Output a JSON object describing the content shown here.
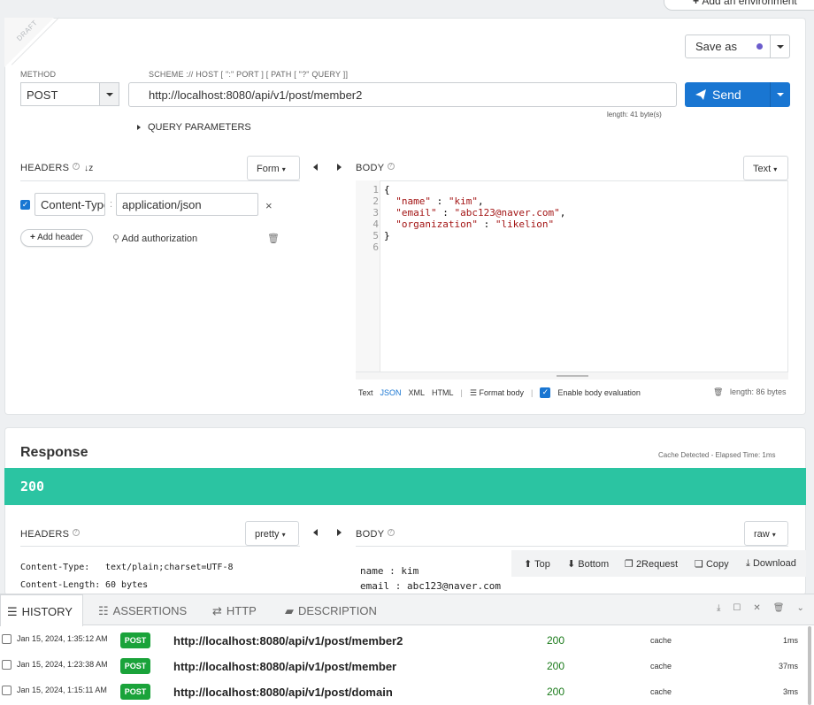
{
  "env": {
    "label": "Add an environment"
  },
  "draft": {
    "label": "DRAFT"
  },
  "request": {
    "method_label": "METHOD",
    "method_value": "POST",
    "scheme_label": "SCHEME :// HOST [ \":\" PORT ] [ PATH [ \"?\" QUERY ]]",
    "url": "http://localhost:8080/api/v1/post/member2",
    "url_length": "length: 41 byte(s)",
    "query_params": "QUERY PARAMETERS",
    "save_as": "Save as",
    "send": "Send"
  },
  "req_headers": {
    "title": "HEADERS",
    "mode": "Form",
    "rows": [
      {
        "name": "Content-Type",
        "value": "application/json"
      }
    ],
    "add_header": "Add header",
    "add_auth": "Add authorization"
  },
  "req_body": {
    "title": "BODY",
    "mode": "Text",
    "lines": [
      {
        "no": "1",
        "text": "{"
      },
      {
        "no": "2",
        "key": "\"name\"",
        "sep": " : ",
        "val": "\"kim\"",
        "end": ","
      },
      {
        "no": "3",
        "key": "\"email\"",
        "sep": " : ",
        "val": "\"abc123@naver.com\"",
        "end": ","
      },
      {
        "no": "4",
        "key": "\"organization\"",
        "sep": " : ",
        "val": "\"likelion\"",
        "end": ""
      },
      {
        "no": "5",
        "text": ""
      },
      {
        "no": "6",
        "text": "}"
      }
    ],
    "formats": [
      "Text",
      "JSON",
      "XML",
      "HTML"
    ],
    "format_body": "Format body",
    "enable_eval": "Enable body evaluation",
    "length": "length: 86 bytes"
  },
  "response": {
    "title": "Response",
    "cache_info": "Cache Detected - Elapsed Time: 1ms",
    "status": "200",
    "headers_title": "HEADERS",
    "headers_mode": "pretty",
    "headers": [
      {
        "name": "Content-Type:",
        "value": "text/plain;charset=UTF-8"
      },
      {
        "name": "Content-Length:",
        "value": "60 bytes"
      }
    ],
    "body_title": "BODY",
    "body_mode": "raw",
    "body_actions": {
      "top": "Top",
      "bottom": "Bottom",
      "request": "2Request",
      "copy": "Copy",
      "download": "Download"
    },
    "body_lines": [
      "name : kim",
      "email : abc123@naver.com"
    ]
  },
  "history": {
    "tabs": [
      "HISTORY",
      "ASSERTIONS",
      "HTTP",
      "DESCRIPTION"
    ],
    "rows": [
      {
        "date": "Jan 15, 2024, 1:35:12 AM",
        "method": "POST",
        "url": "http://localhost:8080/api/v1/post/member2",
        "status": "200",
        "cache": "cache",
        "time": "1ms"
      },
      {
        "date": "Jan 15, 2024, 1:23:38 AM",
        "method": "POST",
        "url": "http://localhost:8080/api/v1/post/member",
        "status": "200",
        "cache": "cache",
        "time": "37ms"
      },
      {
        "date": "Jan 15, 2024, 1:15:11 AM",
        "method": "POST",
        "url": "http://localhost:8080/api/v1/post/domain",
        "status": "200",
        "cache": "cache",
        "time": "3ms"
      }
    ]
  }
}
